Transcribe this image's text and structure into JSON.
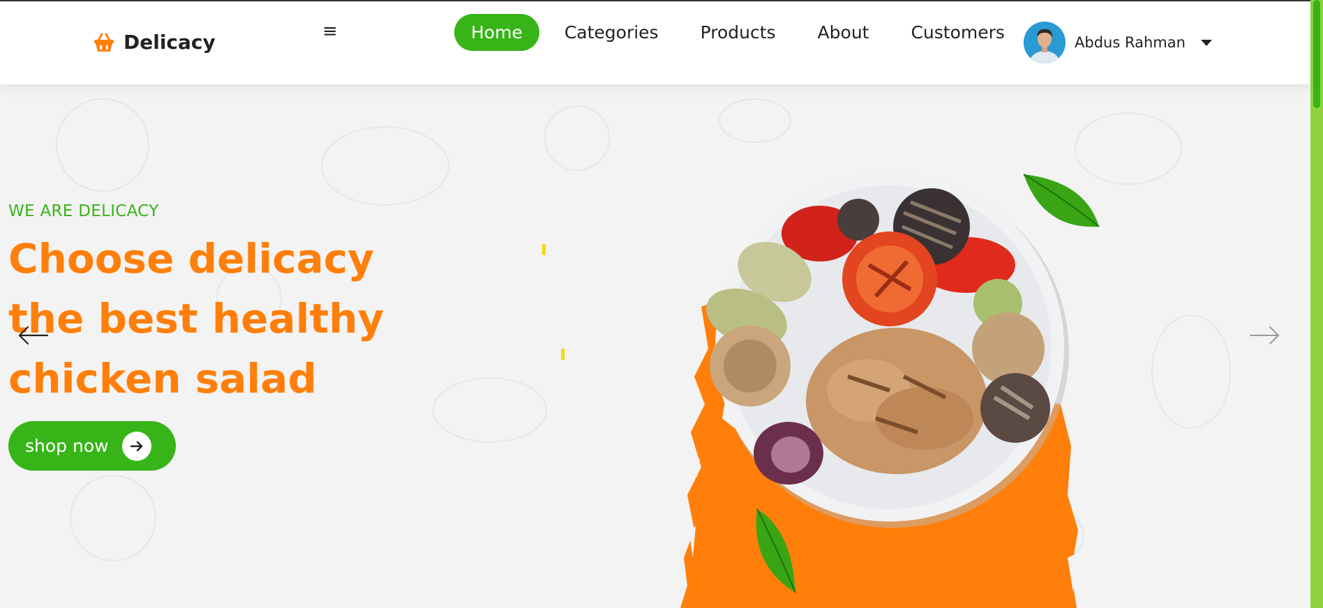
{
  "brand": {
    "name": "Delicacy",
    "icon": "basket-icon"
  },
  "menu_icon": "≡",
  "nav": {
    "items": [
      {
        "label": "Home",
        "active": true
      },
      {
        "label": "Categories",
        "active": false
      },
      {
        "label": "Products",
        "active": false
      },
      {
        "label": "About",
        "active": false
      },
      {
        "label": "Customers",
        "active": false
      }
    ]
  },
  "user": {
    "name": "Abdus Rahman",
    "avatar": "avatar-photo"
  },
  "hero": {
    "tagline": "WE ARE DELICACY",
    "headline_lines": [
      "Choose delicacy",
      "the best healthy",
      "chicken salad"
    ],
    "cta_label": "shop now",
    "image": "grilled chicken and vegetables plate"
  },
  "colors": {
    "accent_green": "#37b417",
    "accent_orange": "#ff7f0a",
    "scroll_track": "#8fd23e"
  }
}
